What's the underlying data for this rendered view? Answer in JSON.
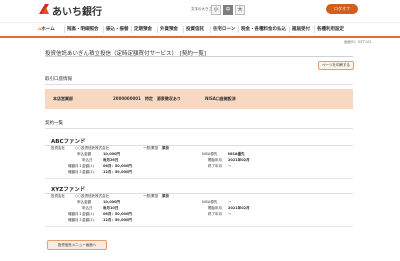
{
  "header": {
    "bank_name": "あいち銀行",
    "font_size_label": "文字の大きさ",
    "font_sizes": [
      "小",
      "中",
      "大"
    ],
    "logout_label": "ログオフ"
  },
  "nav": {
    "items": [
      "ホーム",
      "残高・明細照会",
      "振込・振替",
      "定期預金",
      "外貨預金",
      "投資信託",
      "住宅ローン",
      "税金・各種料金の払込",
      "諸届受付",
      "各種利用設定"
    ]
  },
  "page": {
    "id": "画面ID：BTT102",
    "title": "投資信託あいぎん積立投信（定時定額買付サービス）　[契約一覧]",
    "detail_button": "ページを印刷する",
    "account_section_title": "取引口座情報",
    "account": {
      "branch": "本店営業部",
      "number": "2000000001　特定　源泉徴収あり",
      "nisa": "NISA口座開設済"
    },
    "contract_section_title": "契約一覧",
    "menu_button": "投資信託メニュー画面へ"
  },
  "funds": [
    {
      "name": "ABCファンド",
      "company_label": "投資会社",
      "company": "○○投資信託株式会社",
      "type_label": "一般/累投",
      "type": "累投",
      "nisa_label": "NISA優先",
      "nisa": "NISA優先",
      "amount_label": "申込金額",
      "amount": "10,000円",
      "start_label": "開始年月",
      "start": "2021年02月",
      "date_label": "申込日",
      "date": "毎月26日",
      "end_label": "終了年月",
      "end": "－",
      "bonus1_label": "増額月１金額(1)",
      "bonus1": "06月：50,000円",
      "bonus2_label": "増額月１金額(2)",
      "bonus2": "12月：50,000円"
    },
    {
      "name": "XYZファンド",
      "company_label": "投資会社",
      "company": "○○投資信託株式会社",
      "type_label": "一般/累投",
      "type": "累投",
      "nisa_label": "NISA優先",
      "nisa": "－",
      "amount_label": "申込金額",
      "amount": "10,000円",
      "start_label": "開始年月",
      "start": "2021年02月",
      "date_label": "申込日",
      "date": "毎月10日",
      "end_label": "終了年月",
      "end": "－",
      "bonus1_label": "増額月１金額(1)",
      "bonus1": "06月：50,000円",
      "bonus2_label": "増額月１金額(2)",
      "bonus2": "12月：50,000円"
    }
  ],
  "colors": {
    "accent": "#e26d22",
    "account_bg": "#f8d8c0",
    "logout": "#d35d1a"
  }
}
